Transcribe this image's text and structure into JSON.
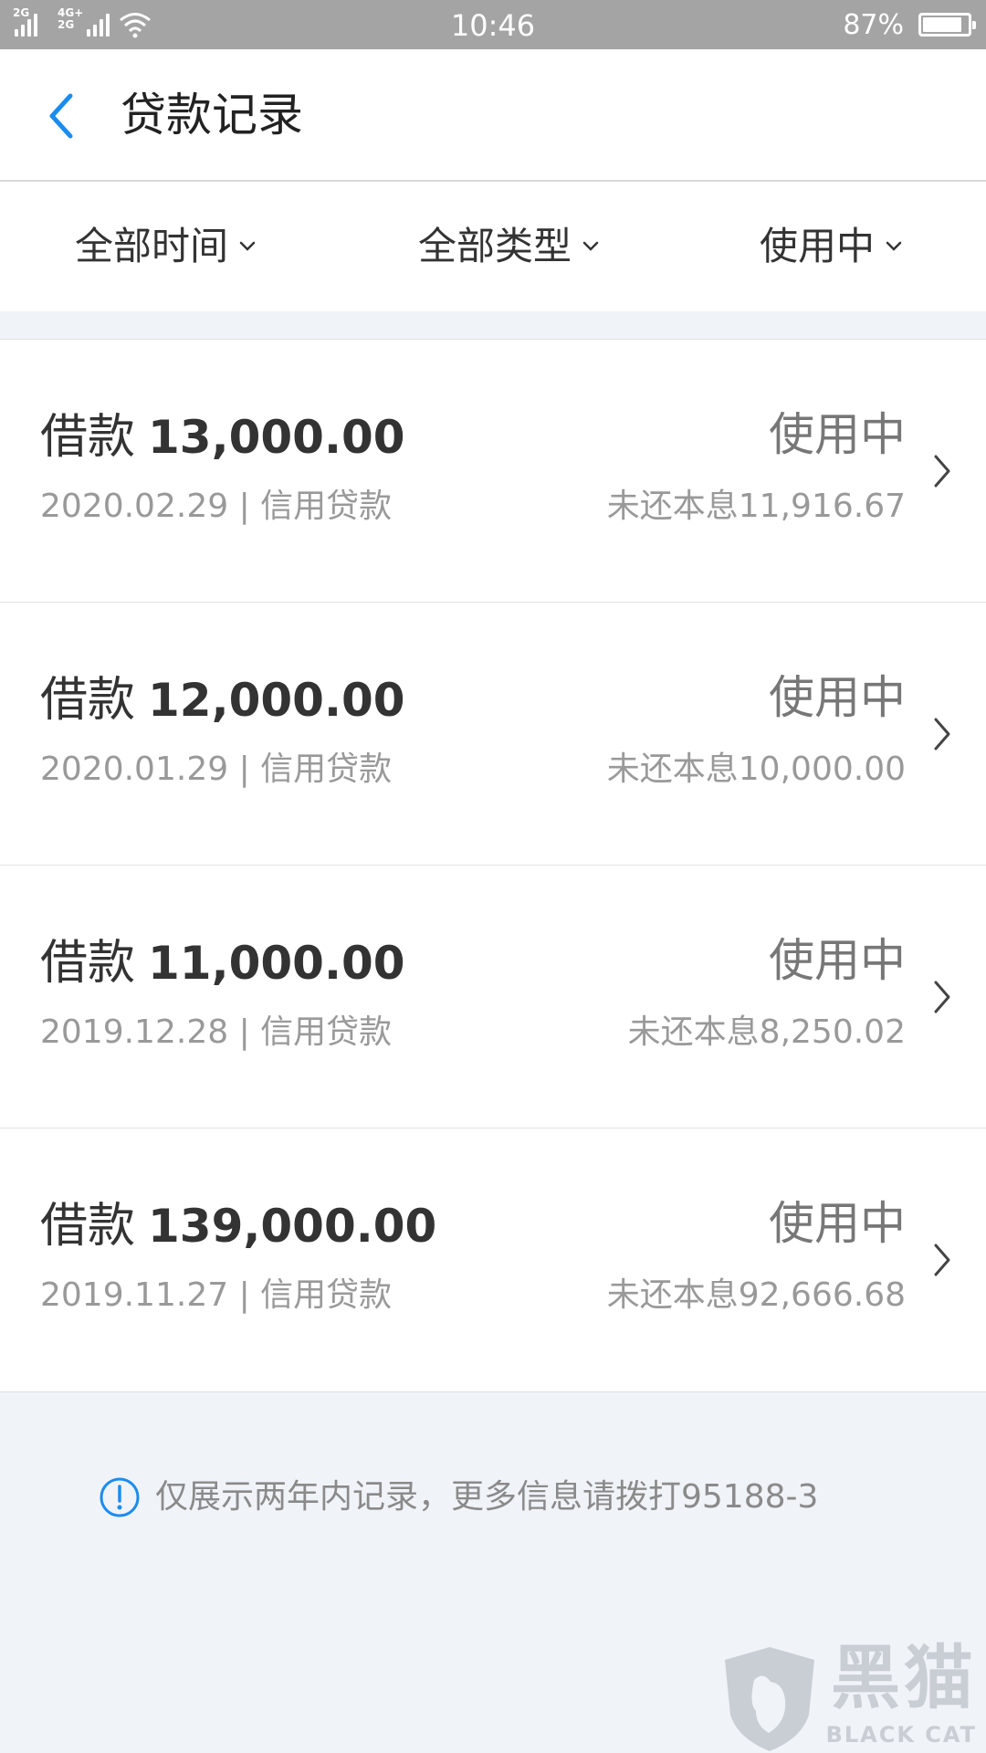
{
  "status_bar": {
    "network_1": "2G",
    "network_2_top": "4G+",
    "network_2_bottom": "2G",
    "time": "10:46",
    "battery_text": "87%",
    "battery_level": 0.87
  },
  "header": {
    "title": "贷款记录"
  },
  "filters": {
    "time": "全部时间",
    "type": "全部类型",
    "status": "使用中"
  },
  "loans": [
    {
      "prefix": "借款",
      "amount": "13,000.00",
      "date": "2020.02.29",
      "sep": "|",
      "kind": "信用贷款",
      "status": "使用中",
      "remaining": "未还本息11,916.67"
    },
    {
      "prefix": "借款",
      "amount": "12,000.00",
      "date": "2020.01.29",
      "sep": "|",
      "kind": "信用贷款",
      "status": "使用中",
      "remaining": "未还本息10,000.00"
    },
    {
      "prefix": "借款",
      "amount": "11,000.00",
      "date": "2019.12.28",
      "sep": "|",
      "kind": "信用贷款",
      "status": "使用中",
      "remaining": "未还本息8,250.02"
    },
    {
      "prefix": "借款",
      "amount": "139,000.00",
      "date": "2019.11.27",
      "sep": "|",
      "kind": "信用贷款",
      "status": "使用中",
      "remaining": "未还本息92,666.68"
    }
  ],
  "footer": {
    "note": "仅展示两年内记录，更多信息请拨打95188-3"
  },
  "watermark": {
    "cn": "黑猫",
    "en": "BLACK CAT"
  },
  "colors": {
    "accent": "#1a8cf0",
    "background": "#f0f3f8",
    "statusbar": "#a4a4a4"
  }
}
